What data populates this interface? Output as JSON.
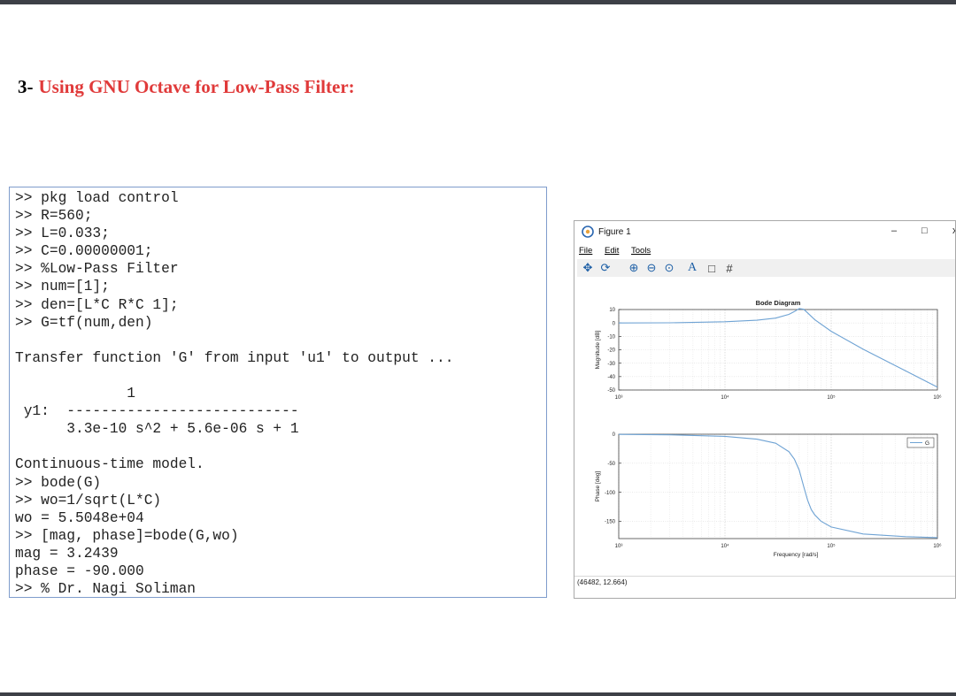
{
  "heading": {
    "number": "3-",
    "title": "Using GNU Octave for Low-Pass Filter:"
  },
  "console": {
    "lines": [
      ">> pkg load control",
      ">> R=560;",
      ">> L=0.033;",
      ">> C=0.00000001;",
      ">> %Low-Pass Filter",
      ">> num=[1];",
      ">> den=[L*C R*C 1];",
      ">> G=tf(num,den)",
      "",
      "Transfer function 'G' from input 'u1' to output ...",
      "",
      "             1",
      " y1:  ---------------------------",
      "      3.3e-10 s^2 + 5.6e-06 s + 1",
      "",
      "Continuous-time model.",
      ">> bode(G)",
      ">> wo=1/sqrt(L*C)",
      "wo = 5.5048e+04",
      ">> [mag, phase]=bode(G,wo)",
      "mag = 3.2439",
      "phase = -90.000",
      ">> % Dr. Nagi Soliman"
    ]
  },
  "figure": {
    "window_title": "Figure 1",
    "window_buttons": {
      "minimize": "–",
      "maximize": "□",
      "close": "x"
    },
    "menu": [
      "File",
      "Edit",
      "Tools"
    ],
    "toolbar_icons": [
      "pan-icon",
      "rotate-icon",
      "zoom-in-icon",
      "zoom-out-icon",
      "zoom-reset-icon",
      "text-icon",
      "axes-box-icon",
      "grid-icon"
    ],
    "status": "(46482, 12.664)",
    "line_color": "#6fa3d4"
  },
  "chart_data": [
    {
      "type": "line",
      "title": "Bode Diagram",
      "ylabel": "Magnitude [dB]",
      "xlabel": "",
      "xscale": "log",
      "xlim": [
        1000,
        1000000
      ],
      "ylim": [
        -50,
        10
      ],
      "x_ticks": [
        "10³",
        "10⁴",
        "10⁵",
        "10⁶"
      ],
      "y_ticks": [
        "10",
        "0",
        "-10",
        "-20",
        "-30",
        "-40",
        "-50"
      ],
      "grid": true,
      "series": [
        {
          "x": [
            1000,
            3000,
            10000,
            20000,
            30000,
            40000,
            45000,
            50000,
            55048,
            60000,
            70000,
            100000,
            200000,
            500000,
            1000000
          ],
          "values": [
            0,
            0.08,
            0.9,
            2.0,
            3.6,
            6.4,
            8.5,
            10.7,
            10.2,
            7.5,
            2.5,
            -6.2,
            -19.6,
            -35.7,
            -47.8
          ]
        }
      ]
    },
    {
      "type": "line",
      "title": "",
      "ylabel": "Phase [deg]",
      "xlabel": "Frequency [rad/s]",
      "xscale": "log",
      "xlim": [
        1000,
        1000000
      ],
      "ylim": [
        -180,
        0
      ],
      "x_ticks": [
        "10³",
        "10⁴",
        "10⁵",
        "10⁶"
      ],
      "y_ticks": [
        "0",
        "-50",
        "-100",
        "-150"
      ],
      "grid": true,
      "legend": {
        "position": "top-right",
        "entries": [
          "G"
        ]
      },
      "series": [
        {
          "name": "G",
          "x": [
            1000,
            3000,
            10000,
            20000,
            30000,
            40000,
            45000,
            50000,
            55048,
            60000,
            65000,
            70000,
            80000,
            100000,
            200000,
            500000,
            1000000
          ],
          "values": [
            -0.3,
            -1.0,
            -3.6,
            -8.6,
            -15.6,
            -30.0,
            -43.0,
            -62.0,
            -90.0,
            -114.0,
            -130.0,
            -139.0,
            -150.0,
            -160.0,
            -172.0,
            -176.6,
            -178.3
          ]
        }
      ]
    }
  ]
}
